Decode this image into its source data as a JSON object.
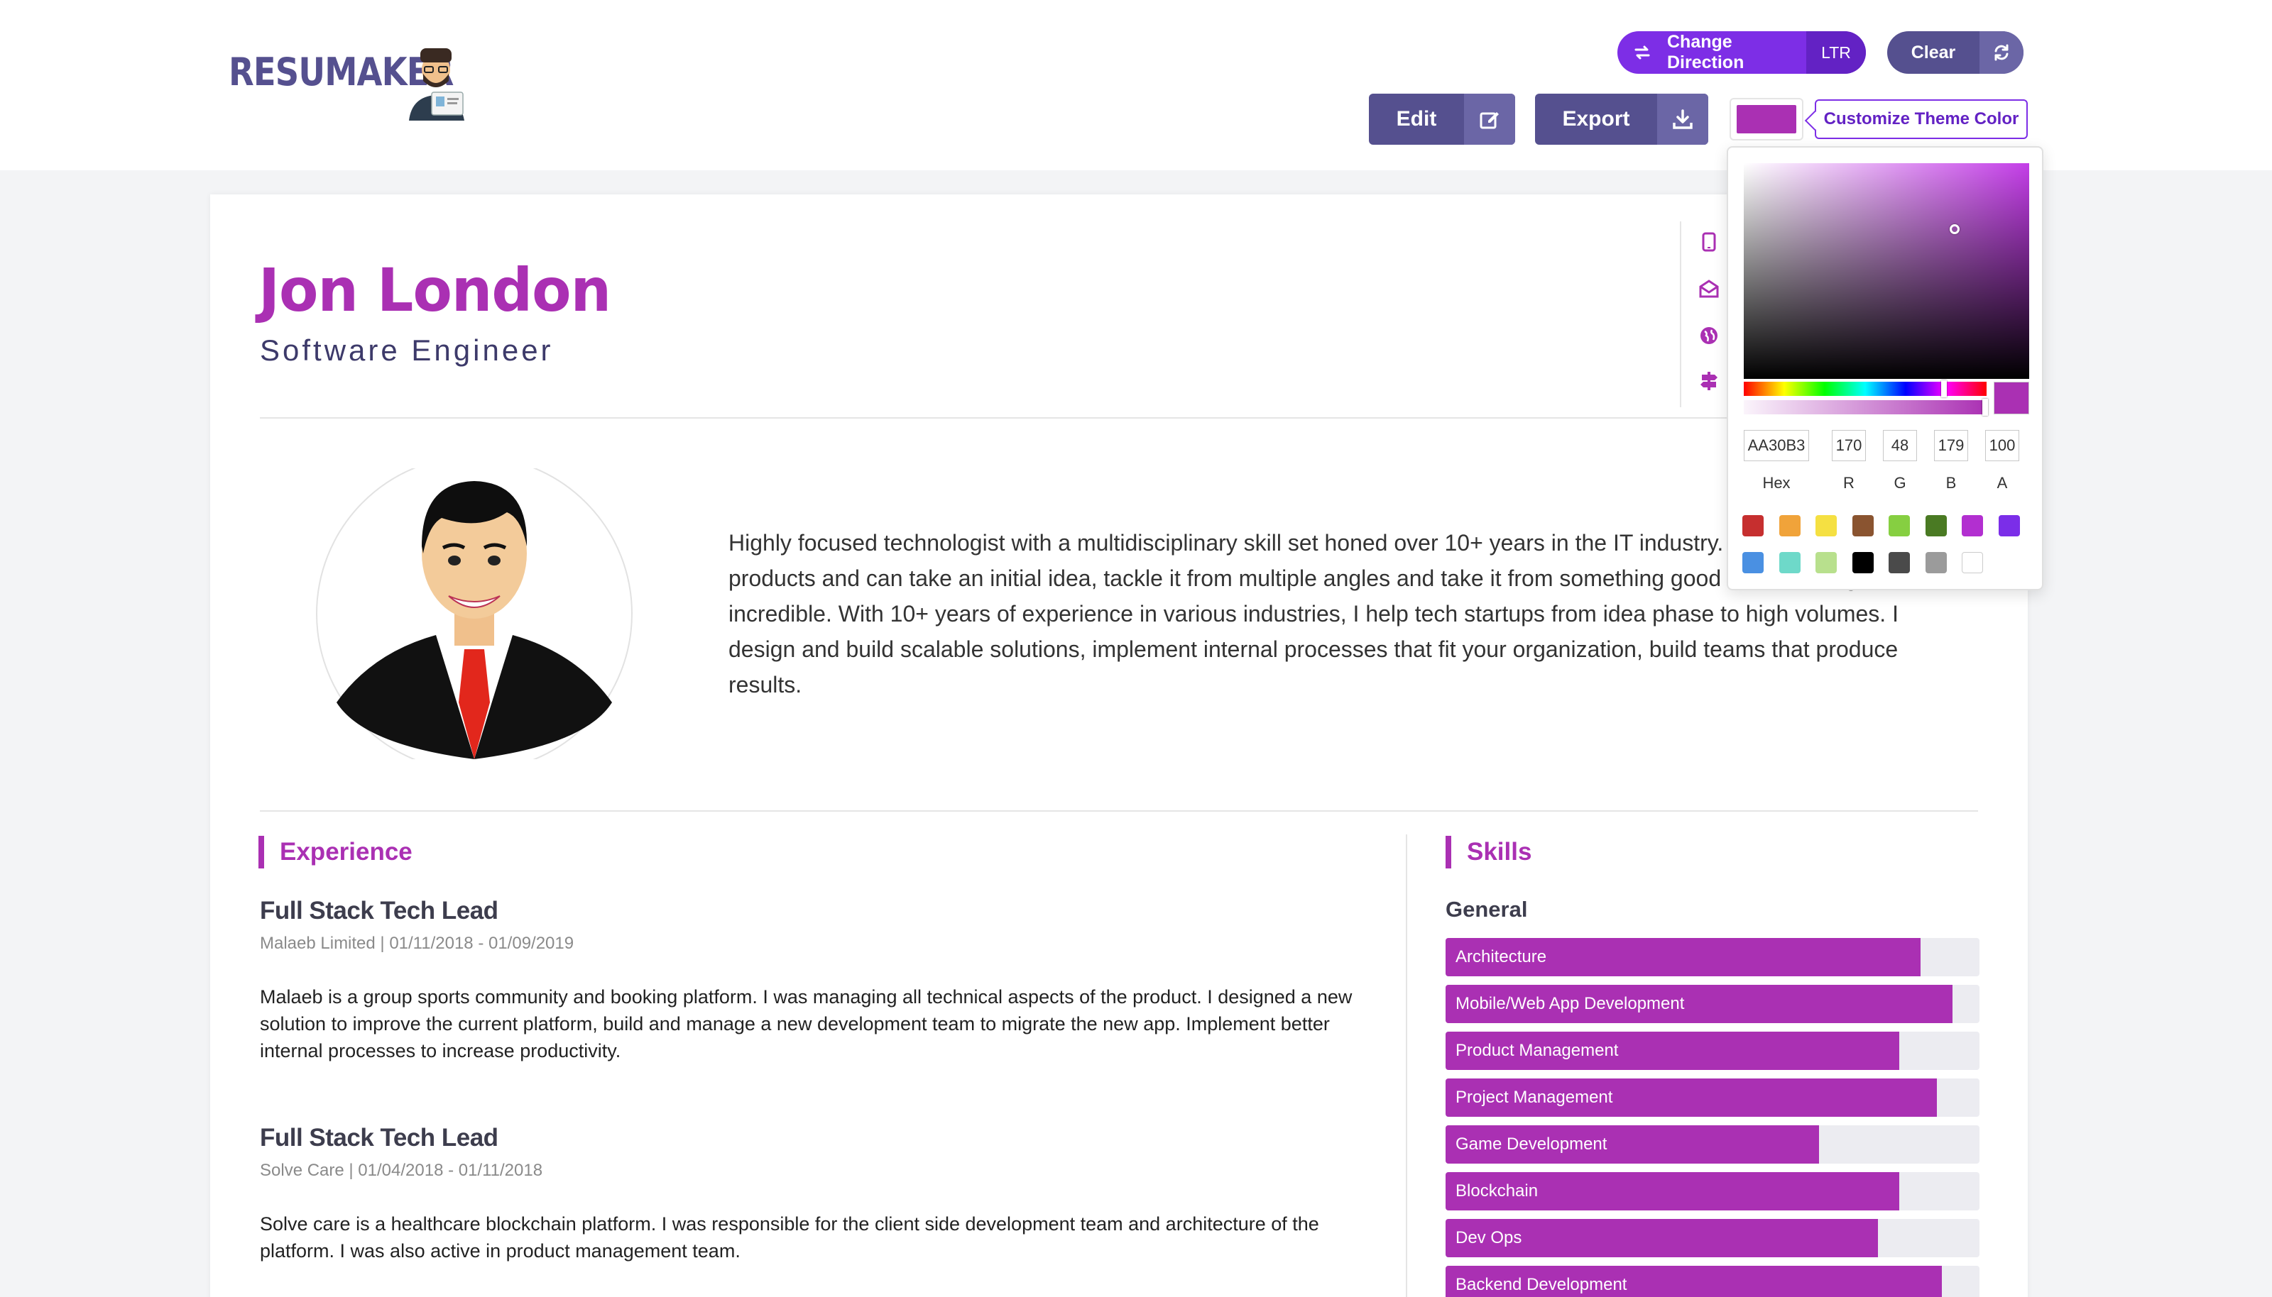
{
  "logo": {
    "text": "RESUMAKER"
  },
  "toolbar": {
    "change_direction_label": "Change Direction",
    "direction_value": "LTR",
    "clear_label": "Clear",
    "edit_label": "Edit",
    "export_label": "Export",
    "customize_label": "Customize Theme Color"
  },
  "theme": {
    "accent": "#aa30b3",
    "primary": "#55508f",
    "button_purple": "#7d2ee6"
  },
  "profile": {
    "name": "Jon London",
    "title": "Software Engineer",
    "summary": "Highly focused technologist with a multidisciplinary skill set honed over 10+ years in the IT industry. I love building great products and can take an initial idea, tackle it from multiple angles and take it from something good to something incredible. With 10+ years of experience in various industries, I help tech startups from idea phase to high volumes. I design and build scalable solutions, implement internal processes that fit your organization, build teams that produce results."
  },
  "contact_icons": [
    "mobile-icon",
    "email-icon",
    "globe-icon",
    "address-icon"
  ],
  "experience": {
    "heading": "Experience",
    "items": [
      {
        "title": "Full Stack Tech Lead",
        "meta": "Malaeb Limited | 01/11/2018 - 01/09/2019",
        "description": "Malaeb is a group sports community and booking platform. I was managing all technical aspects of the product. I designed a new solution to improve the current platform, build and manage a new development team to migrate the new app. Implement better internal processes to increase productivity."
      },
      {
        "title": "Full Stack Tech Lead",
        "meta": "Solve Care | 01/04/2018 - 01/11/2018",
        "description": "Solve care is a healthcare blockchain platform. I was responsible for the client side development team and architecture of the platform. I was also active in product management team."
      }
    ]
  },
  "skills": {
    "heading": "Skills",
    "group": "General",
    "items": [
      {
        "label": "Architecture",
        "level": 0.89
      },
      {
        "label": "Mobile/Web App Development",
        "level": 0.95
      },
      {
        "label": "Product Management",
        "level": 0.85
      },
      {
        "label": "Project Management",
        "level": 0.92
      },
      {
        "label": "Game Development",
        "level": 0.7
      },
      {
        "label": "Blockchain",
        "level": 0.85
      },
      {
        "label": "Dev Ops",
        "level": 0.81
      },
      {
        "label": "Backend Development",
        "level": 0.93
      }
    ]
  },
  "color_picker": {
    "hex": "AA30B3",
    "r": "170",
    "g": "48",
    "b": "179",
    "a": "100",
    "labels": {
      "hex": "Hex",
      "r": "R",
      "g": "G",
      "b": "B",
      "a": "A"
    },
    "presets": [
      "#c62f2f",
      "#f0a33a",
      "#f5e042",
      "#8a5430",
      "#86cf41",
      "#4a7a23",
      "#b22fd0",
      "#7b2ee8",
      "#4a90e2",
      "#6ed9c9",
      "#b8e08d",
      "#000000",
      "#4a4a4a",
      "#9b9b9b",
      "#ffffff"
    ]
  }
}
